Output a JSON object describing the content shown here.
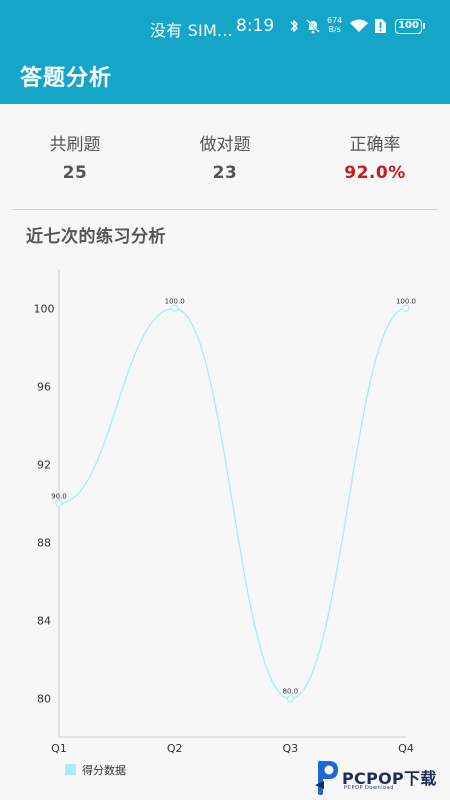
{
  "status_bar": {
    "carrier": "没有 SIM...",
    "time": "8:19",
    "net_speed_value": "674",
    "net_speed_unit": "B/s",
    "battery": "100"
  },
  "app_bar": {
    "title": "答题分析"
  },
  "stats": [
    {
      "label": "共刷题",
      "value": "25"
    },
    {
      "label": "做对题",
      "value": "23"
    },
    {
      "label": "正确率",
      "value": "92.0%",
      "color": "#c81c1c"
    }
  ],
  "section_title": "近七次的练习分析",
  "colors": {
    "primary": "#14a5c9",
    "line": "#a6ecfa",
    "accent_red": "#c81c1c"
  },
  "chart_data": {
    "type": "line",
    "categories": [
      "Q1",
      "Q2",
      "Q3",
      "Q4"
    ],
    "series": [
      {
        "name": "得分数据",
        "values": [
          90.0,
          100.0,
          80.0,
          100.0
        ]
      }
    ],
    "value_labels": [
      "90.0",
      "100.0",
      "80.0",
      "100.0"
    ],
    "y_ticks": [
      "80",
      "84",
      "88",
      "92",
      "96",
      "100"
    ],
    "ylim": [
      78.04,
      101.96
    ],
    "smooth": true,
    "grid": false,
    "legend_position": "bottom-left"
  },
  "watermark": {
    "text": "PCPOP下载",
    "sub": "PCPOP Download"
  }
}
